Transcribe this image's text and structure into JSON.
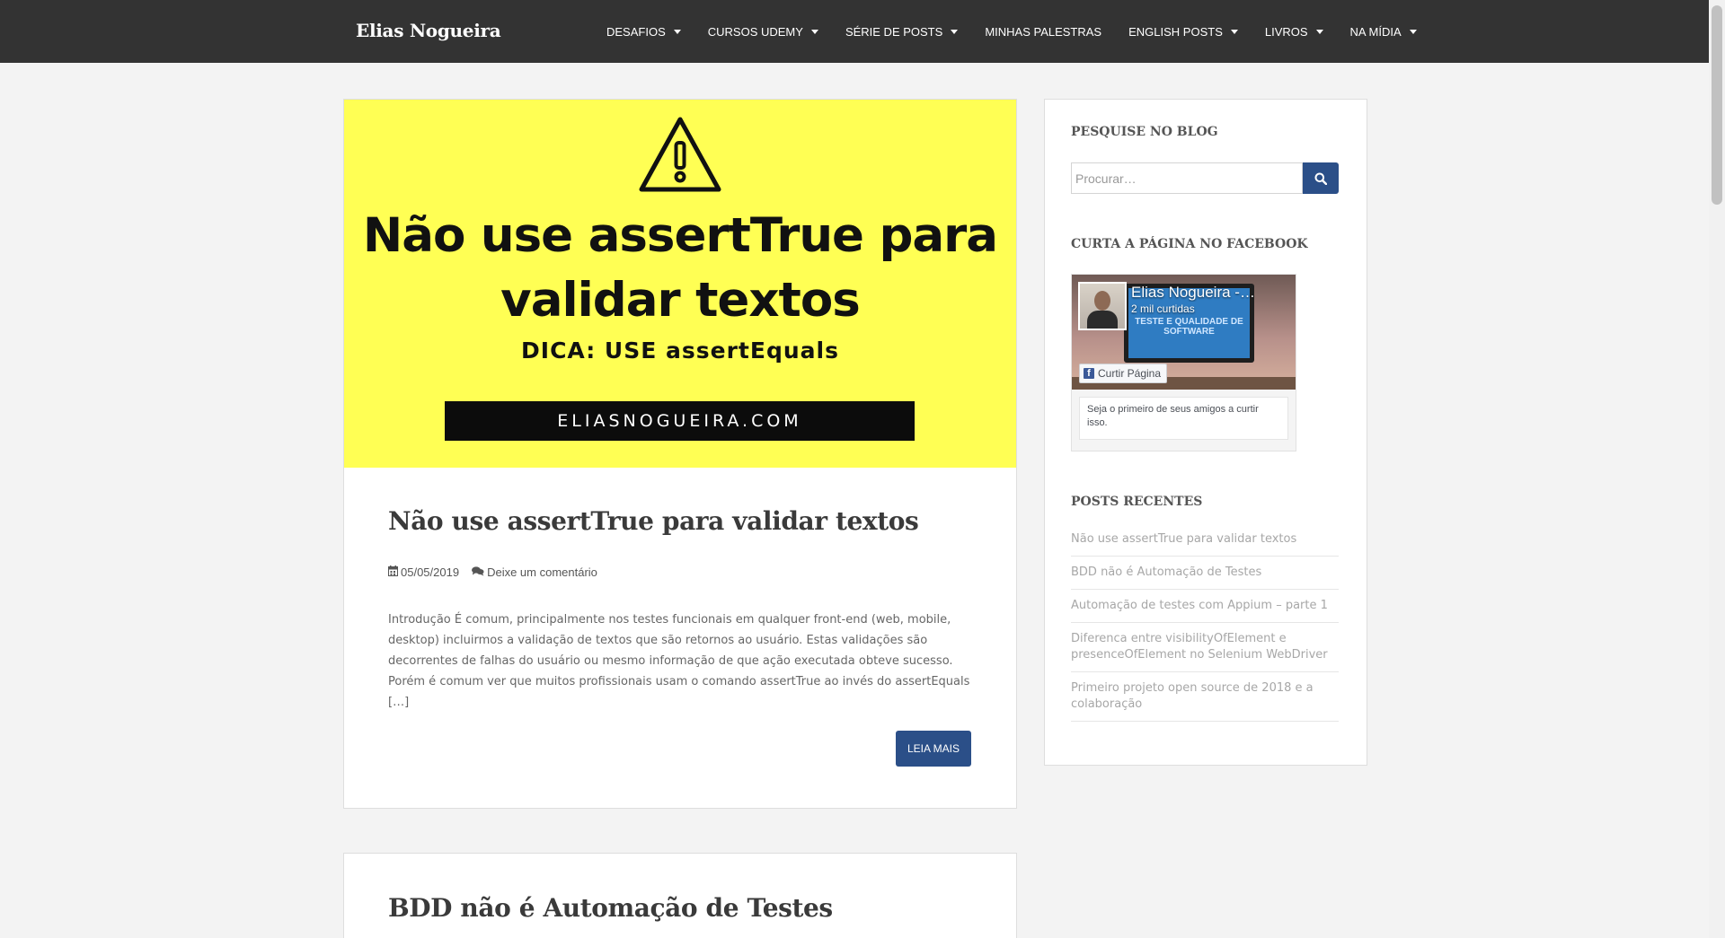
{
  "site": {
    "brand": "Elias Nogueira"
  },
  "nav": {
    "items": [
      {
        "label": "DESAFIOS",
        "has_dropdown": true
      },
      {
        "label": "CURSOS UDEMY",
        "has_dropdown": true
      },
      {
        "label": "SÉRIE DE POSTS",
        "has_dropdown": true
      },
      {
        "label": "MINHAS PALESTRAS",
        "has_dropdown": false
      },
      {
        "label": "ENGLISH POSTS",
        "has_dropdown": true
      },
      {
        "label": "LIVROS",
        "has_dropdown": true
      },
      {
        "label": "NA MÍDIA",
        "has_dropdown": true
      }
    ]
  },
  "posts": [
    {
      "featured_image": {
        "title_line1": "Não use assertTrue para",
        "title_line2": "validar textos",
        "subtitle": "DICA: USE assertEquals",
        "band_text": "ELIASNOGUEIRA.COM",
        "icon": "warning-icon",
        "bg_color": "#ffff54"
      },
      "title": "Não use assertTrue para validar textos",
      "date": "05/05/2019",
      "comments": "Deixe um comentário",
      "excerpt": "Introdução É comum, principalmente nos testes funcionais em qualquer front-end (web, mobile, desktop) incluirmos a validação de textos que são retornos ao usuário. Estas validações são decorrentes de falhas do usuário ou mesmo informação de que ação executada obteve sucesso. Porém é comum ver que muitos profissionais usam o comando assertTrue ao invés do assertEquals […]",
      "read_more": "LEIA MAIS"
    },
    {
      "title": "BDD não é Automação de Testes"
    }
  ],
  "sidebar": {
    "search": {
      "title": "PESQUISE NO BLOG",
      "placeholder": "Procurar…",
      "icon": "search-icon"
    },
    "facebook": {
      "title": "CURTA A PÁGINA NO FACEBOOK",
      "page_name": "Elias Nogueira -…",
      "likes": "2 mil curtidas",
      "cover_text": "TESTE E QUALIDADE DE SOFTWARE",
      "like_button": "Curtir Página",
      "friends_text": "Seja o primeiro de seus amigos a curtir isso."
    },
    "recent": {
      "title": "POSTS RECENTES",
      "items": [
        "Não use assertTrue para validar textos",
        "BDD não é Automação de Testes",
        "Automação de testes com Appium – parte 1",
        "Diferenca entre visibilityOfElement e presenceOfElement no Selenium WebDriver",
        "Primeiro projeto open source de 2018 e a colaboração"
      ]
    }
  },
  "colors": {
    "navbar": "#333333",
    "accent_button": "#2b4f88",
    "page_bg": "#f3f3f3",
    "facebook_blue": "#3b5998"
  }
}
